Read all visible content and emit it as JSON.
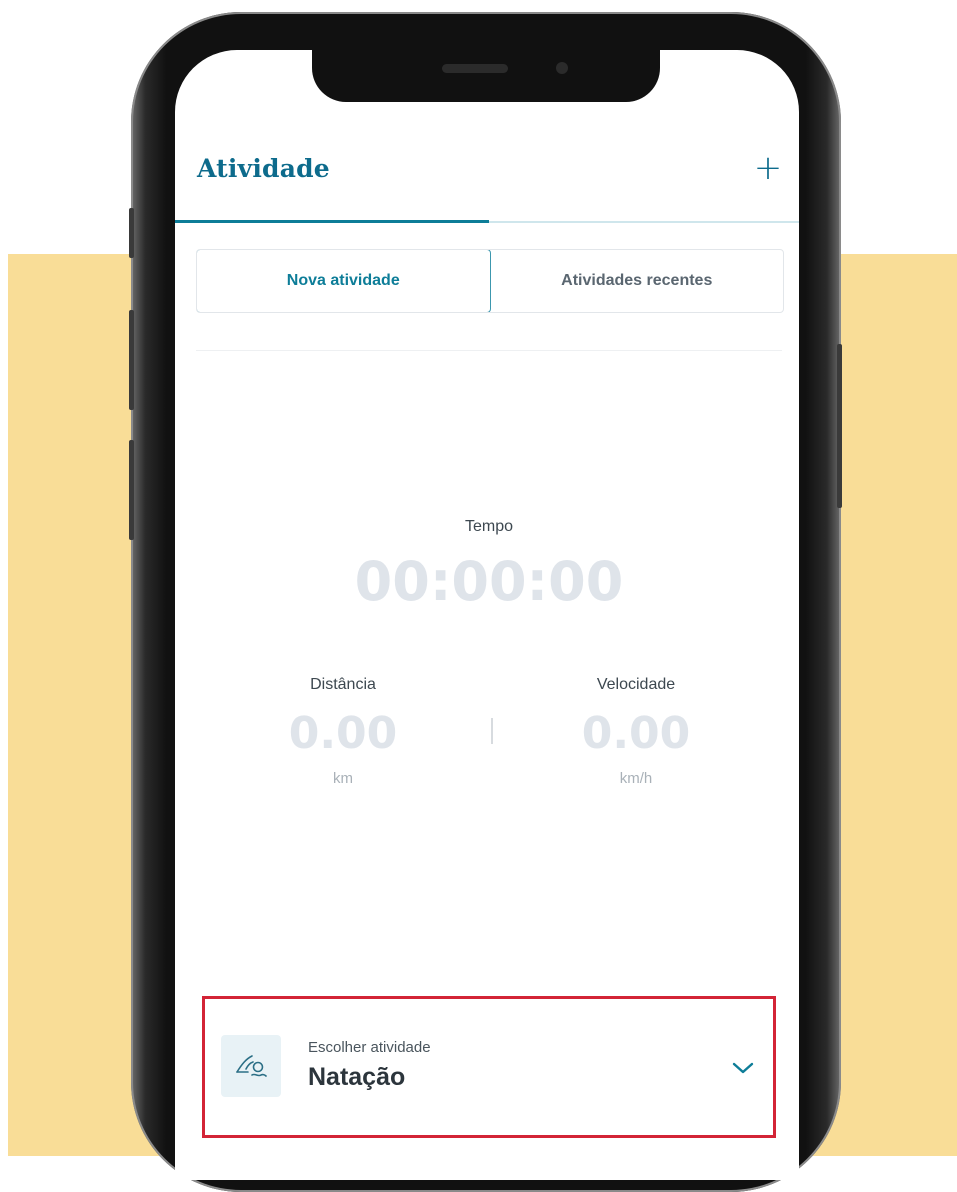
{
  "app": {
    "title": "Atividade",
    "add_label": "+"
  },
  "tabs": [
    {
      "label": "Nova atividade",
      "active": true
    },
    {
      "label": "Atividades recentes",
      "active": false
    }
  ],
  "stats": {
    "time": {
      "label": "Tempo",
      "value": "00:00:00"
    },
    "distance": {
      "label": "Distância",
      "value": "0.00",
      "unit": "km"
    },
    "speed": {
      "label": "Velocidade",
      "value": "0.00",
      "unit": "km/h"
    }
  },
  "picker": {
    "subtitle": "Escolher atividade",
    "selected": "Natação",
    "icon": "swimming-icon"
  },
  "colors": {
    "accent": "#0d6b8c",
    "highlight": "#d32436",
    "background": "#f9dd97"
  }
}
